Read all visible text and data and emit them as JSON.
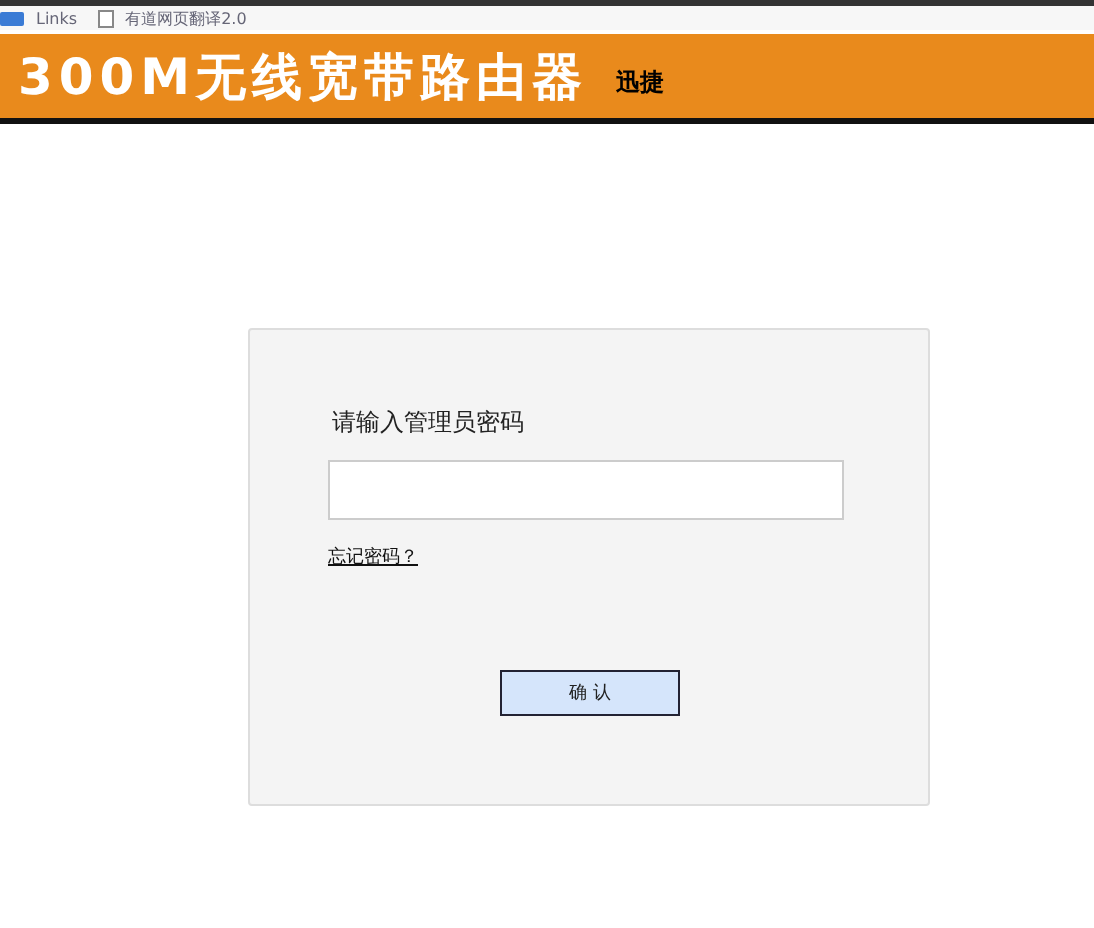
{
  "bookmarks": [
    "Links",
    "有道网页翻译2.0"
  ],
  "header": {
    "title": "300M无线宽带路由器",
    "brand": "迅捷"
  },
  "login": {
    "label": "请输入管理员密码",
    "forgot_link": "忘记密码？",
    "button": "确 认"
  }
}
